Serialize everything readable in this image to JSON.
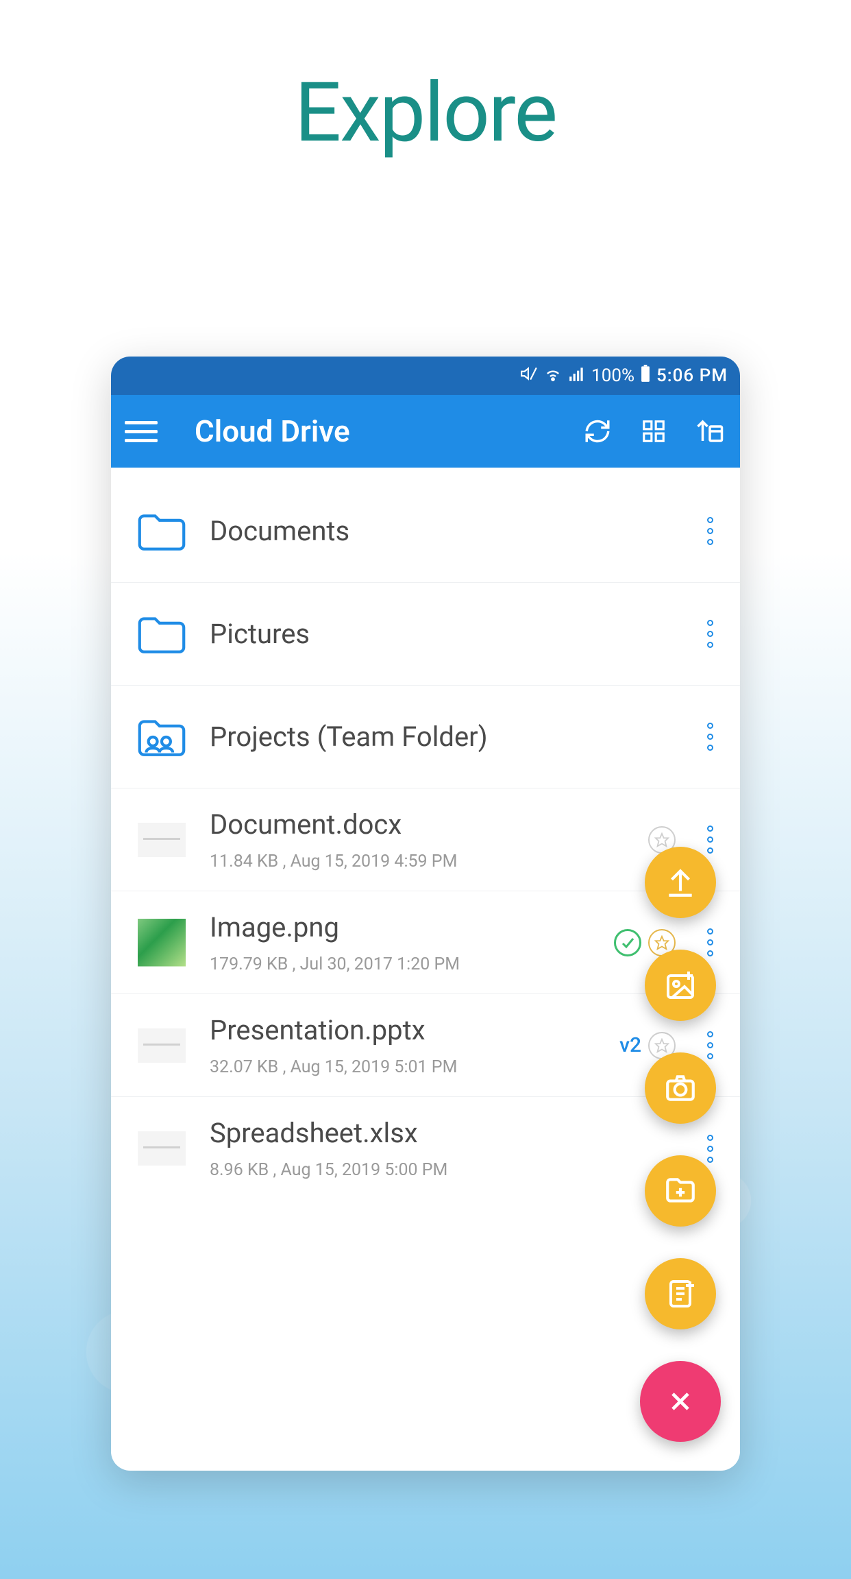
{
  "page": {
    "title": "Explore"
  },
  "status_bar": {
    "muted_icon": "volume-mute",
    "wifi_icon": "wifi",
    "signal_icon": "signal-full",
    "battery_percent": "100%",
    "battery_icon": "battery-full",
    "time": "5:06 PM"
  },
  "app_bar": {
    "menu_icon": "hamburger-menu",
    "title": "Cloud Drive",
    "sync_icon": "sync",
    "grid_icon": "grid-view",
    "sort_icon": "sort-up-date"
  },
  "colors": {
    "accent": "#1f8ce6",
    "status_bar": "#1e6bb8",
    "fab_yellow": "#f6b92d",
    "fab_pink": "#ef3b72",
    "title_teal": "#1a8f87"
  },
  "items": [
    {
      "type": "folder",
      "icon": "folder",
      "name": "Documents",
      "meta": ""
    },
    {
      "type": "folder",
      "icon": "folder",
      "name": "Pictures",
      "meta": ""
    },
    {
      "type": "folder",
      "icon": "team-folder",
      "name": "Projects (Team Folder)",
      "meta": ""
    },
    {
      "type": "file",
      "icon": "doc",
      "name": "Document.docx",
      "meta": "11.84 KB , Aug 15, 2019 4:59 PM",
      "badges": [
        "star-outline"
      ]
    },
    {
      "type": "file",
      "icon": "image-thumb",
      "name": "Image.png",
      "meta": "179.79 KB , Jul 30, 2017 1:20 PM",
      "badges": [
        "check-green",
        "star-gold"
      ]
    },
    {
      "type": "file",
      "icon": "doc",
      "name": "Presentation.pptx",
      "meta": "32.07 KB , Aug 15, 2019 5:01 PM",
      "badges": [
        "version:v2",
        "star-outline"
      ]
    },
    {
      "type": "file",
      "icon": "doc",
      "name": "Spreadsheet.xlsx",
      "meta": "8.96 KB , Aug 15, 2019 5:00 PM",
      "badges": []
    }
  ],
  "fab_actions": [
    {
      "icon": "upload",
      "name": "upload"
    },
    {
      "icon": "add-image",
      "name": "add-image"
    },
    {
      "icon": "camera",
      "name": "camera"
    },
    {
      "icon": "add-folder",
      "name": "add-folder"
    },
    {
      "icon": "add-note",
      "name": "add-note"
    }
  ],
  "fab_main": {
    "icon": "close",
    "name": "close-fab"
  }
}
